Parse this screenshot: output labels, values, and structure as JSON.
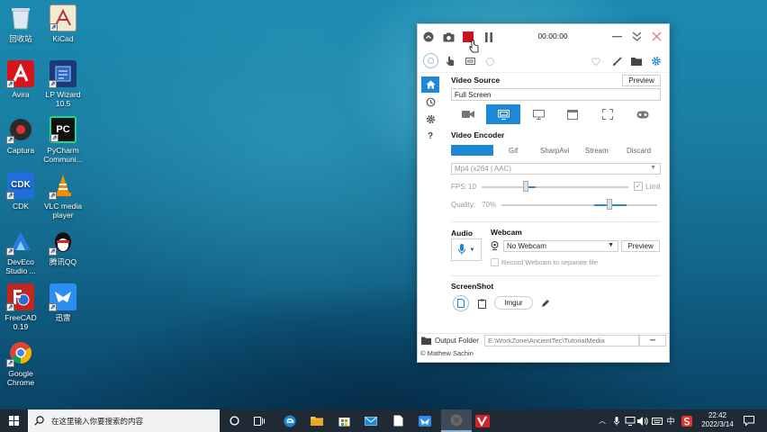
{
  "desktop": {
    "icons": [
      {
        "label": "回收站"
      },
      {
        "label": "KiCad"
      },
      {
        "label": "Avira"
      },
      {
        "label": "LP Wizard 10.5"
      },
      {
        "label": "Captura"
      },
      {
        "label": "PyCharm Communi..."
      },
      {
        "label": "CDK"
      },
      {
        "label": "VLC media player"
      },
      {
        "label": "DevEco Studio ..."
      },
      {
        "label": "腾讯QQ"
      },
      {
        "label": "FreeCAD 0.19"
      },
      {
        "label": "迅雷"
      },
      {
        "label": "Google Chrome"
      }
    ]
  },
  "recorder": {
    "timer": "00:00:00",
    "video_source": {
      "title": "Video Source",
      "preview": "Preview",
      "value": "Full Screen"
    },
    "video_encoder": {
      "title": "Video Encoder",
      "tabs": [
        "FFmpeg",
        "Gif",
        "SharpAvi",
        "Stream",
        "Discard"
      ],
      "format": "Mp4 (x264 | AAC)",
      "fps_label": "FPS:",
      "fps_value": "10",
      "limit_label": "Limit",
      "quality_label": "Quality:",
      "quality_value": "70%"
    },
    "audio": {
      "title": "Audio"
    },
    "webcam": {
      "title": "Webcam",
      "value": "No Webcam",
      "preview": "Preview",
      "separate_label": "Record Webcam to separate file"
    },
    "screenshot": {
      "title": "ScreenShot",
      "imgur": "Imgur"
    },
    "output": {
      "label": "Output Folder",
      "path": "E:\\WorkZone\\AncientTec\\TutorialMedia",
      "more": "•••"
    },
    "footer": "© Mathew Sachin"
  },
  "colors": {
    "accent": "#1e88d8",
    "stop": "#c8141e",
    "taskbar": "#1f2a35"
  },
  "taskbar": {
    "search_placeholder": "在这里输入你要搜索的内容",
    "ime": "中",
    "time": "22:42",
    "date": "2022/3/14"
  }
}
